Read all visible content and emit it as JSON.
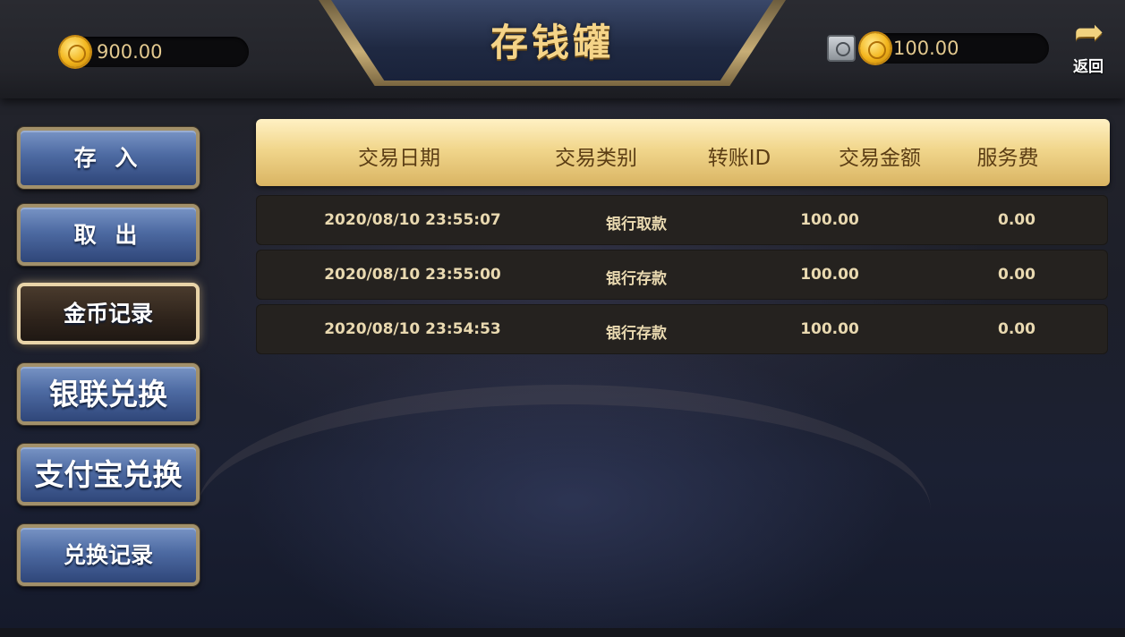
{
  "header": {
    "title": "存钱罐",
    "wallet_balance": "900.00",
    "bank_balance": "100.00",
    "back_label": "返回"
  },
  "menu": [
    {
      "label": "存 入",
      "active": false
    },
    {
      "label": "取 出",
      "active": false
    },
    {
      "label": "金币记录",
      "active": true
    },
    {
      "label": "银联兑换",
      "active": false
    },
    {
      "label": "支付宝兑换",
      "active": false
    },
    {
      "label": "兑换记录",
      "active": false
    }
  ],
  "table": {
    "columns": [
      "交易日期",
      "交易类别",
      "转账ID",
      "交易金额",
      "服务费"
    ],
    "rows": [
      {
        "date": "2020/08/10 23:55:07",
        "type": "银行取款",
        "transfer_id": "",
        "amount": "100.00",
        "fee": "0.00"
      },
      {
        "date": "2020/08/10 23:55:00",
        "type": "银行存款",
        "transfer_id": "",
        "amount": "100.00",
        "fee": "0.00"
      },
      {
        "date": "2020/08/10 23:54:53",
        "type": "银行存款",
        "transfer_id": "",
        "amount": "100.00",
        "fee": "0.00"
      }
    ]
  },
  "colors": {
    "gold_text": "#f5d488",
    "header_gold": "#f1d68c",
    "button_blue": "#4d6aa2",
    "row_bg": "#25221f"
  },
  "icons": [
    "coin-icon",
    "safe-icon",
    "back-arrow-icon"
  ]
}
